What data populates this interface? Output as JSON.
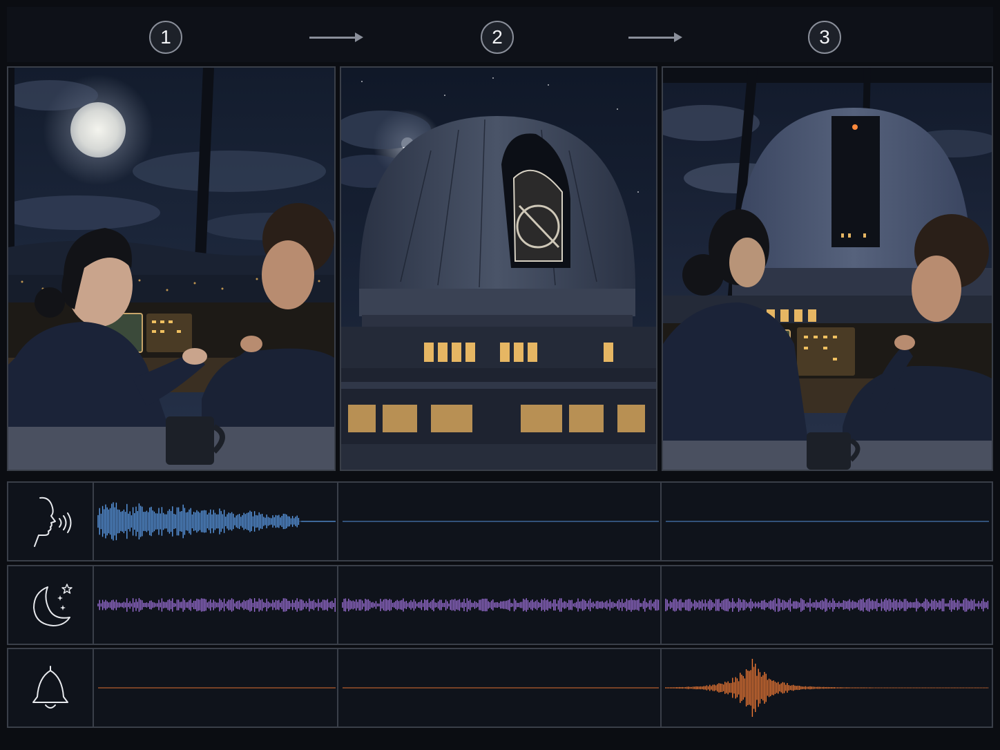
{
  "steps": [
    {
      "number": "1"
    },
    {
      "number": "2"
    },
    {
      "number": "3"
    }
  ],
  "scenes": [
    {
      "icon": "scene-conversation-in-control-room",
      "description_icon": "two-people-talking-moonlit-observatory"
    },
    {
      "icon": "scene-observatory-dome-opening"
    },
    {
      "icon": "scene-people-watching-dome"
    }
  ],
  "tracks": [
    {
      "id": "dialogue",
      "icon": "speaking-head-icon",
      "color": "#5b9be6",
      "activity": [
        1,
        0,
        0
      ]
    },
    {
      "id": "night-ambience",
      "icon": "moon-stars-icon",
      "color": "#9b6fd6",
      "activity": [
        1,
        1,
        1
      ]
    },
    {
      "id": "bell",
      "icon": "bell-icon",
      "color": "#f07a34",
      "activity": [
        0,
        0,
        1
      ]
    }
  ],
  "colors": {
    "background": "#0b0d12",
    "border": "#3a3f49",
    "dialogue": "#5b9be6",
    "ambience": "#9b6fd6",
    "bell": "#f07a34"
  }
}
